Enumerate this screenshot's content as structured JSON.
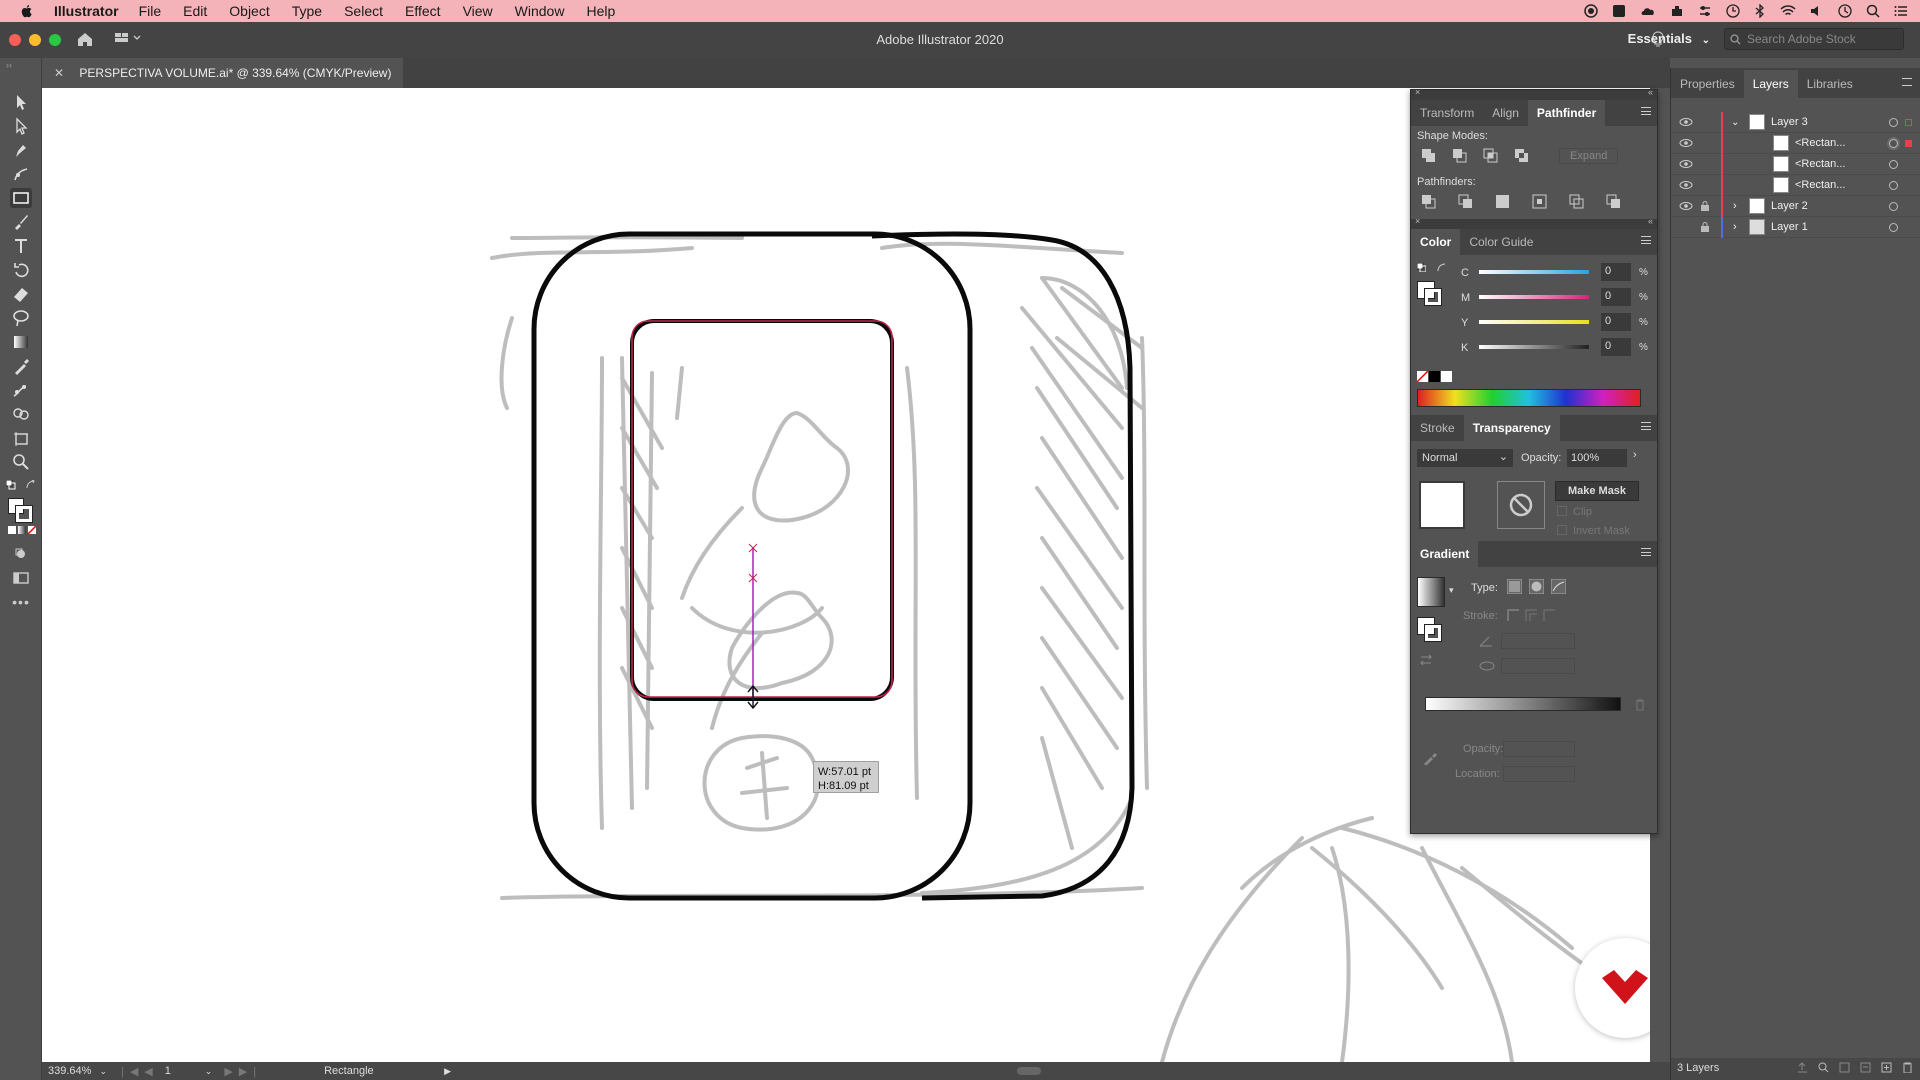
{
  "menubar": {
    "app": "Illustrator",
    "items": [
      "File",
      "Edit",
      "Object",
      "Type",
      "Select",
      "Effect",
      "View",
      "Window",
      "Help"
    ]
  },
  "appbar": {
    "title": "Adobe Illustrator 2020",
    "workspace": "Essentials",
    "search_placeholder": "Search Adobe Stock"
  },
  "document": {
    "tab_title": "PERSPECTIVA VOLUME.ai* @ 339.64% (CMYK/Preview)"
  },
  "canvas": {
    "tooltip_w": "W:57.01 pt",
    "tooltip_h": "H:81.09 pt"
  },
  "pathfinder_panel": {
    "tabs": [
      "Transform",
      "Align",
      "Pathfinder"
    ],
    "shape_modes_label": "Shape Modes:",
    "expand_label": "Expand",
    "pathfinders_label": "Pathfinders:"
  },
  "color_panel": {
    "tabs": [
      "Color",
      "Color Guide"
    ],
    "channels": [
      {
        "label": "C",
        "value": "0",
        "unit": "%",
        "color": "#29a3e0"
      },
      {
        "label": "M",
        "value": "0",
        "unit": "%",
        "color": "#d4267a"
      },
      {
        "label": "Y",
        "value": "0",
        "unit": "%",
        "color": "#e8e01e"
      },
      {
        "label": "K",
        "value": "0",
        "unit": "%",
        "color": "#222222"
      }
    ]
  },
  "transparency_panel": {
    "tabs": [
      "Stroke",
      "Transparency"
    ],
    "blend_mode": "Normal",
    "opacity_label": "Opacity:",
    "opacity_value": "100%",
    "make_mask": "Make Mask",
    "clip": "Clip",
    "invert_mask": "Invert Mask"
  },
  "gradient_panel": {
    "tab": "Gradient",
    "type_label": "Type:",
    "stroke_label": "Stroke:",
    "opacity_label": "Opacity:",
    "location_label": "Location:"
  },
  "right_dock": {
    "tabs": [
      "Properties",
      "Layers",
      "Libraries"
    ],
    "layers": [
      {
        "name": "Layer 3",
        "indent": 0,
        "expanded": true,
        "color": "#e8404f"
      },
      {
        "name": "<Rectan...",
        "indent": 1,
        "color": "#e8404f"
      },
      {
        "name": "<Rectan...",
        "indent": 1,
        "color": "#e8404f"
      },
      {
        "name": "<Rectan...",
        "indent": 1,
        "color": "#e8404f"
      },
      {
        "name": "Layer 2",
        "indent": 0,
        "expanded": false,
        "color": "#e8404f"
      },
      {
        "name": "Layer 1",
        "indent": 0,
        "expanded": false,
        "color": "#4a6fe8"
      }
    ],
    "layer_count": "3 Layers"
  },
  "statusbar": {
    "zoom": "339.64%",
    "artboard": "1",
    "tool": "Rectangle"
  }
}
